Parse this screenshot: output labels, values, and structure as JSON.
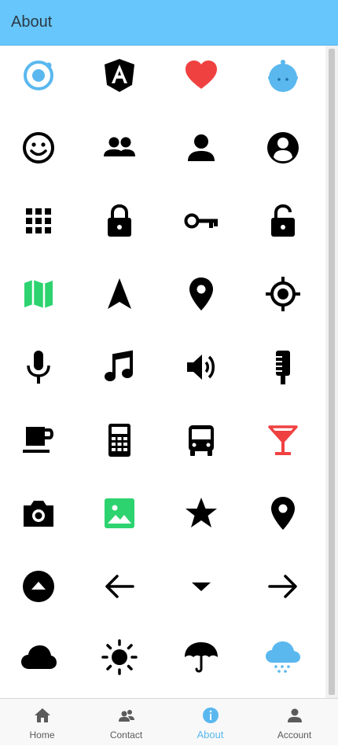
{
  "header": {
    "title": "About"
  },
  "icons": {
    "rows": [
      [
        "ionic-logo-icon",
        "angular-logo-icon",
        "heart-icon",
        "ionitron-icon"
      ],
      [
        "happy-face-icon",
        "people-icon",
        "person-icon",
        "contact-icon"
      ],
      [
        "apps-grid-icon",
        "lock-icon",
        "key-icon",
        "unlock-icon"
      ],
      [
        "map-icon",
        "navigate-icon",
        "pin-icon",
        "locate-icon"
      ],
      [
        "microphone-icon",
        "musical-notes-icon",
        "volume-icon",
        "mic-alt-icon"
      ],
      [
        "coffee-cup-icon",
        "calculator-icon",
        "bus-icon",
        "wine-glass-icon"
      ],
      [
        "camera-icon",
        "image-icon",
        "star-icon",
        "pin-icon"
      ],
      [
        "arrow-dropup-circle-icon",
        "arrow-back-icon",
        "arrow-dropdown-icon",
        "arrow-forward-icon"
      ],
      [
        "cloud-icon",
        "sunny-icon",
        "umbrella-icon",
        "rainy-icon"
      ]
    ]
  },
  "colors": {
    "header_bg": "#67c6fb",
    "accent": "#5ab8ef",
    "ionic_blue": "#5ab8ef",
    "heart_red": "#f04141",
    "map_green": "#2dd36f",
    "wine_red": "#f04141",
    "tab_inactive": "#5b5b5b"
  },
  "tabs": [
    {
      "label": "Home",
      "icon": "home-icon",
      "active": false
    },
    {
      "label": "Contact",
      "icon": "contacts-icon",
      "active": false
    },
    {
      "label": "About",
      "icon": "information-circle-icon",
      "active": true
    },
    {
      "label": "Account",
      "icon": "person-icon",
      "active": false
    }
  ]
}
